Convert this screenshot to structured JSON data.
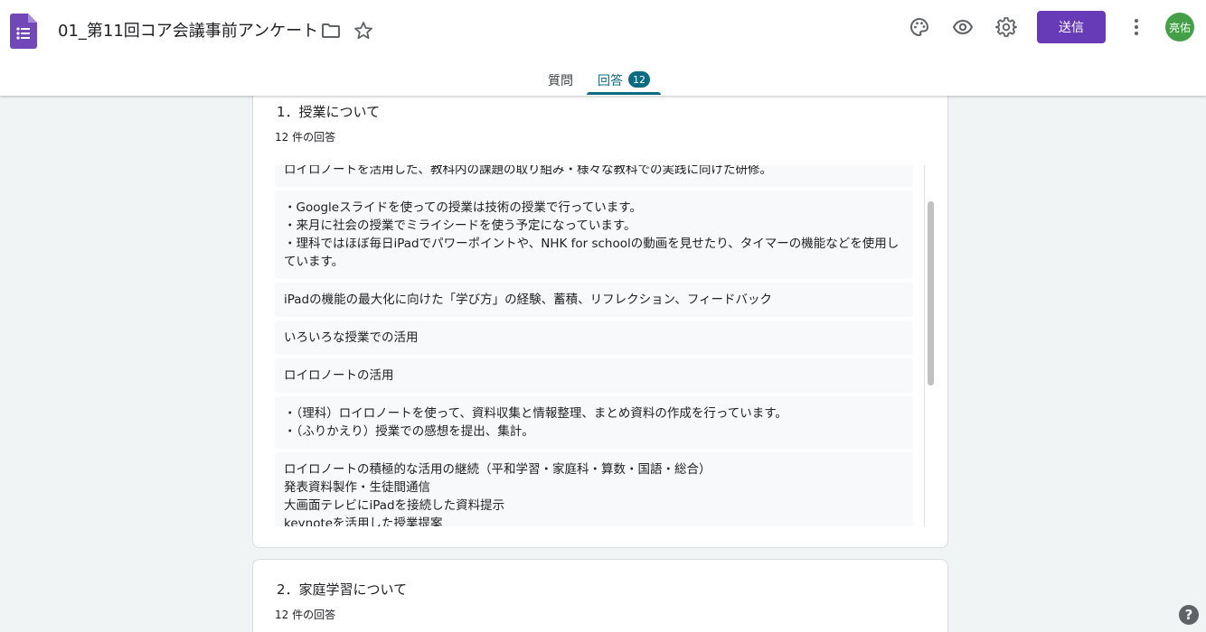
{
  "header": {
    "title": "01_第11回コア会議事前アンケート",
    "send_label": "送信",
    "avatar_text": "亮佑",
    "brand_color": "#673ab7"
  },
  "tabs": {
    "questions_label": "質問",
    "responses_label": "回答",
    "responses_count": "12"
  },
  "sections": [
    {
      "title": "1．授業について",
      "count_text": "12 件の回答",
      "responses": [
        "ロイロノートを活用した、教科内の課題の取り組み・様々な教科での実践に向けた研修。",
        "・Googleスライドを使っての授業は技術の授業で行っています。\n・来月に社会の授業でミライシードを使う予定になっています。\n・理科ではほぼ毎日iPadでパワーポイントや、NHK for schoolの動画を見せたり、タイマーの機能などを使用しています。",
        "iPadの機能の最大化に向けた「学び方」の経験、蓄積、リフレクション、フィードバック",
        "いろいろな授業での活用",
        "ロイロノートの活用",
        "・（理科）ロイロノートを使って、資料収集と情報整理、まとめ資料の作成を行っています。\n・（ふりかえり）授業での感想を提出、集計。",
        "ロイロノートの積極的な活用の継続（平和学習・家庭科・算数・国語・総合）\n発表資料製作・生徒間通信\n大画面テレビにiPadを接続した資料提示\nkeynoteを活用した授業提案"
      ]
    },
    {
      "title": "2．家庭学習について",
      "count_text": "12 件の回答"
    }
  ]
}
